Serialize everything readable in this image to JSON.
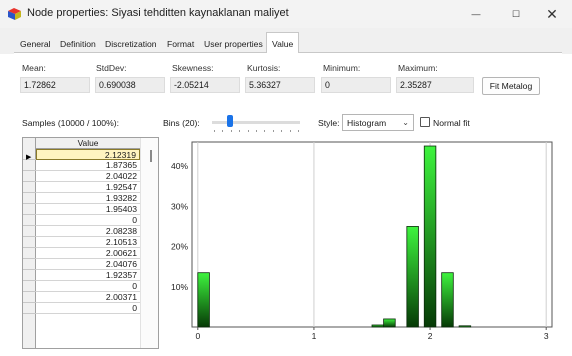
{
  "window": {
    "title": "Node properties: Siyasi tehditten kaynaklanan maliyet",
    "minimize_glyph": "—",
    "maximize_glyph": "☐",
    "close_glyph": "✕"
  },
  "tabs": [
    {
      "label": "General",
      "active": false
    },
    {
      "label": "Definition",
      "active": false
    },
    {
      "label": "Discretization",
      "active": false
    },
    {
      "label": "Format",
      "active": false
    },
    {
      "label": "User properties",
      "active": false
    },
    {
      "label": "Value",
      "active": true
    }
  ],
  "stats": {
    "mean": {
      "label": "Mean:",
      "value": "1.72862"
    },
    "stddev": {
      "label": "StdDev:",
      "value": "0.690038"
    },
    "skewness": {
      "label": "Skewness:",
      "value": "-2.05214"
    },
    "kurtosis": {
      "label": "Kurtosis:",
      "value": "5.36327"
    },
    "minimum": {
      "label": "Minimum:",
      "value": "0"
    },
    "maximum": {
      "label": "Maximum:",
      "value": "2.35287"
    }
  },
  "fit_button": "Fit Metalog",
  "samples_label": "Samples (10000 / 100%):",
  "bins": {
    "label": "Bins (20):",
    "slider_fraction": 0.2
  },
  "style": {
    "label": "Style:",
    "selected": "Histogram",
    "chevron": "⌄"
  },
  "normal_fit": {
    "label": "Normal fit",
    "checked": false
  },
  "grid": {
    "header": "Value",
    "pointer_glyph": "▶",
    "rows": [
      "2.12319",
      "1.87365",
      "2.04022",
      "1.92547",
      "1.93282",
      "1.95403",
      "0",
      "2.08238",
      "2.10513",
      "2.00621",
      "2.04076",
      "1.92357",
      "0",
      "2.00371",
      "0"
    ],
    "selected_index": 0
  },
  "chart_data": {
    "type": "bar",
    "y_tick_labels": [
      "10%",
      "20%",
      "30%",
      "40%"
    ],
    "y_ticks": [
      0.1,
      0.2,
      0.3,
      0.4
    ],
    "x_tick_labels": [
      "0",
      "1",
      "2",
      "3"
    ],
    "x_ticks": [
      0,
      1,
      2,
      3
    ],
    "xlim": [
      -0.05,
      3.05
    ],
    "ylim": [
      0,
      0.46
    ],
    "bin_width": 0.1,
    "bins": [
      {
        "start": 0.0,
        "value": 0.135
      },
      {
        "start": 1.5,
        "value": 0.005
      },
      {
        "start": 1.6,
        "value": 0.02
      },
      {
        "start": 1.8,
        "value": 0.25
      },
      {
        "start": 1.95,
        "value": 0.45
      },
      {
        "start": 2.1,
        "value": 0.135
      },
      {
        "start": 2.25,
        "value": 0.003
      }
    ],
    "grid_vertical": true,
    "grid_horizontal": false,
    "colors": {
      "bar_top": "#3ef43e",
      "bar_bottom": "#063a06",
      "grid": "#cfcfcf"
    }
  }
}
